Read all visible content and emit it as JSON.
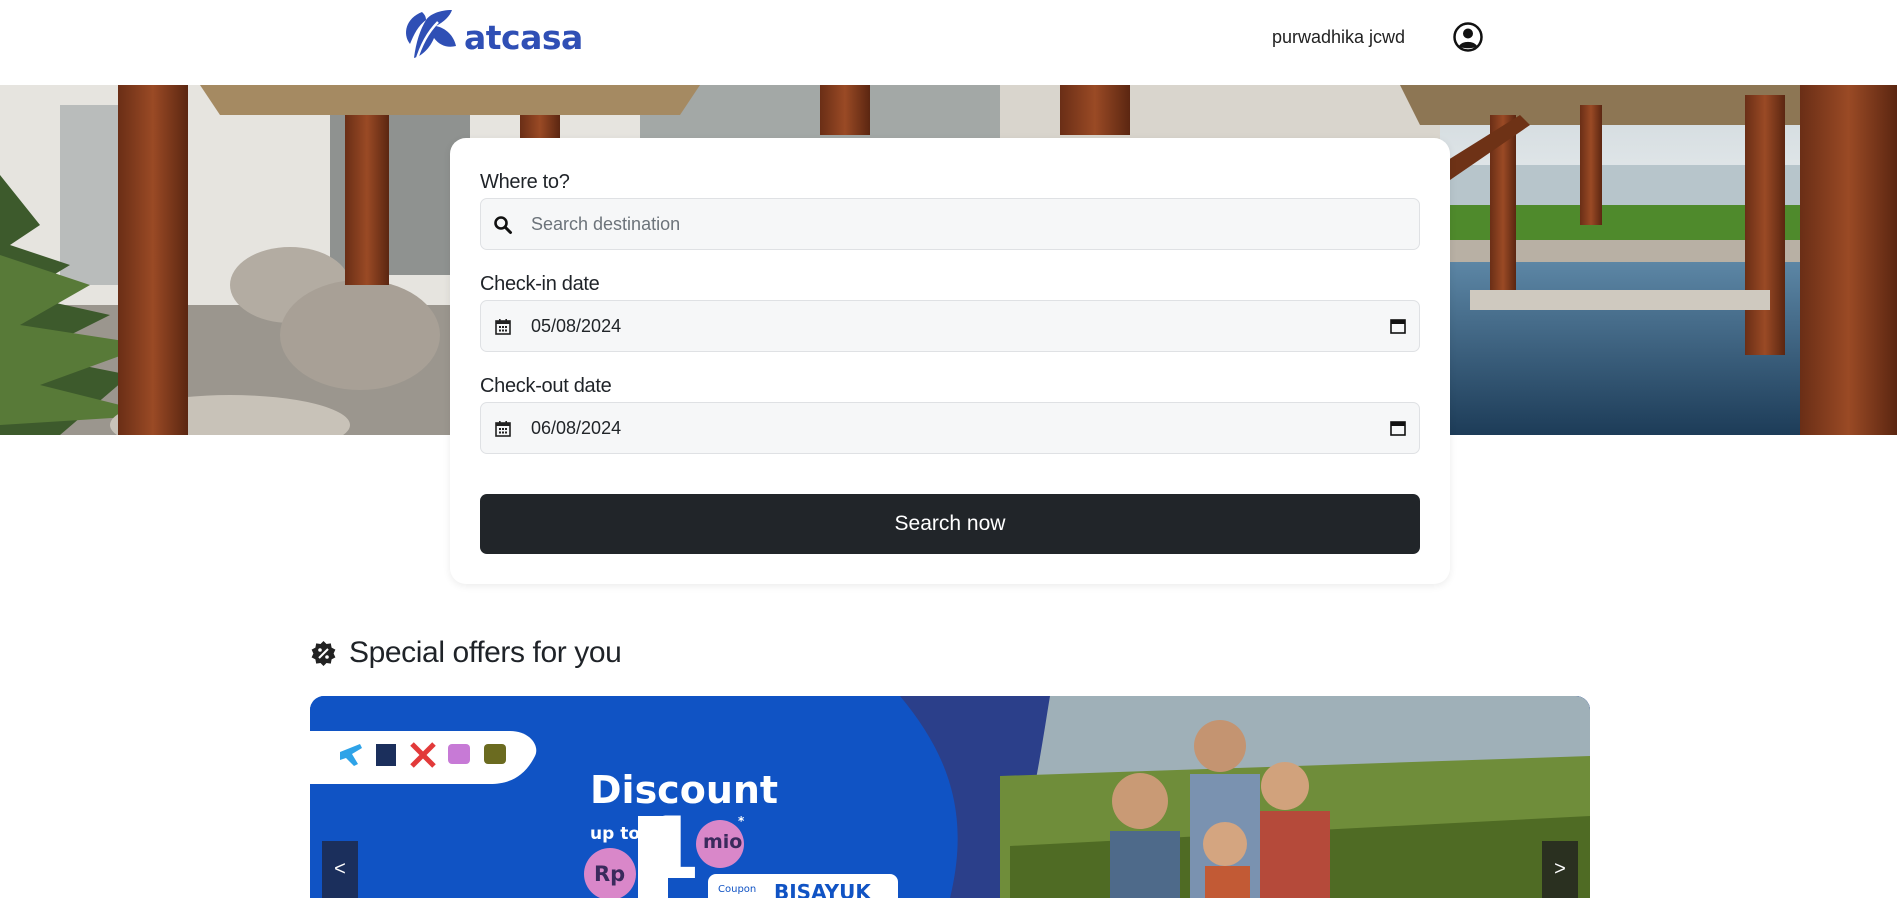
{
  "header": {
    "brand": "atcasa",
    "user_name": "purwadhika jcwd",
    "user_icon": "user-circle-icon"
  },
  "search": {
    "destination_label": "Where to?",
    "destination_placeholder": "Search destination",
    "checkin_label": "Check-in date",
    "checkin_value": "05/08/2024",
    "checkout_label": "Check-out date",
    "checkout_value": "06/08/2024",
    "button_label": "Search now"
  },
  "offers": {
    "title": "Special offers for you",
    "icon": "discount-badge-icon",
    "banner": {
      "headline": "Discount",
      "up_to": "up to",
      "amount": "1",
      "unit": "mio",
      "asterisk": "*",
      "currency": "Rp",
      "coupon_label": "Coupon",
      "coupon_code": "BISAYUK"
    },
    "prev_label": "<",
    "next_label": ">"
  },
  "colors": {
    "brand": "#2f4fb5",
    "button": "#212529",
    "banner_blue": "#1053c4"
  }
}
